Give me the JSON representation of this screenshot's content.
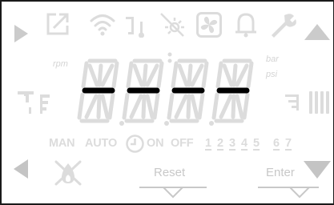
{
  "top_icons": [
    "play-right-icon",
    "external-link-icon",
    "wifi-icon",
    "tap-icon",
    "sun-off-icon",
    "fan-icon",
    "bell-icon",
    "wrench-icon",
    "arrow-up-icon"
  ],
  "display": {
    "digits": [
      "-",
      "-",
      "-",
      "-"
    ],
    "unit_left": "rpm",
    "unit_bar": "bar",
    "unit_psi": "psi"
  },
  "mode": {
    "man": "MAN",
    "auto": "AUTO",
    "on": "ON",
    "off": "OFF",
    "numbers": [
      "1",
      "2",
      "3",
      "4",
      "5",
      "6",
      "7"
    ]
  },
  "softkeys": {
    "reset": "Reset",
    "enter": "Enter"
  },
  "colors": {
    "active": "#000000",
    "ghost": "#dcdcdc",
    "arrow": "#c4c4c4"
  }
}
